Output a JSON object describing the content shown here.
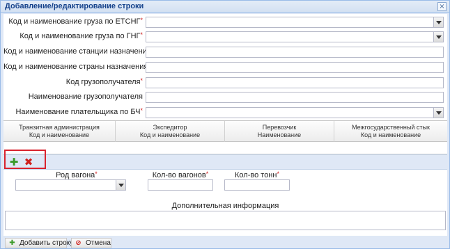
{
  "dialog": {
    "title": "Добавление/редактирование строки",
    "close_glyph": "×",
    "close_icon": "close-icon"
  },
  "form": {
    "cargo_etsng_label": "Код и наименование груза по ЕТСНГ",
    "cargo_etsng_value": "",
    "cargo_gng_label": "Код и наименование груза по ГНГ",
    "cargo_gng_value": "",
    "dest_station_label": "Код и наименование станции назначения",
    "dest_station_value": "",
    "dest_country_label": "Код и наименование страны назначения",
    "dest_country_value": "",
    "consignee_code_label": "Код грузополучателя",
    "consignee_code_value": "",
    "consignee_name_label": "Наименование грузополучателя",
    "consignee_name_value": "",
    "payer_label": "Наименование плательщика по БЧ",
    "payer_value": "",
    "required_mark": "*"
  },
  "grid": {
    "columns": [
      {
        "line1": "Транзитная администрация",
        "line2": "Код и наименование"
      },
      {
        "line1": "Экспедитор",
        "line2": "Код и наименование"
      },
      {
        "line1": "Перевозчик",
        "line2": "Наименование"
      },
      {
        "line1": "Межгосударственный стык",
        "line2": "Код и наименование"
      }
    ],
    "rows": []
  },
  "grid_toolbar": {
    "add_glyph": "✚",
    "add_icon": "add-icon",
    "delete_glyph": "✖",
    "delete_icon": "delete-icon",
    "highlight_color": "#d9232e"
  },
  "wagon": {
    "type_label": "Род вагона",
    "type_value": "",
    "count_label": "Кол-во вагонов",
    "count_value": "",
    "tons_label": "Кол-во тонн",
    "tons_value": ""
  },
  "extra": {
    "label": "Дополнительная информация",
    "value": ""
  },
  "footer": {
    "add_row_label": "Добавить строку",
    "add_row_glyph": "✚",
    "cancel_label": "Отмена",
    "cancel_glyph": "⊘"
  },
  "colors": {
    "accent": "#15428b",
    "panel_bg": "#dfe8f6",
    "required": "#d02020"
  }
}
